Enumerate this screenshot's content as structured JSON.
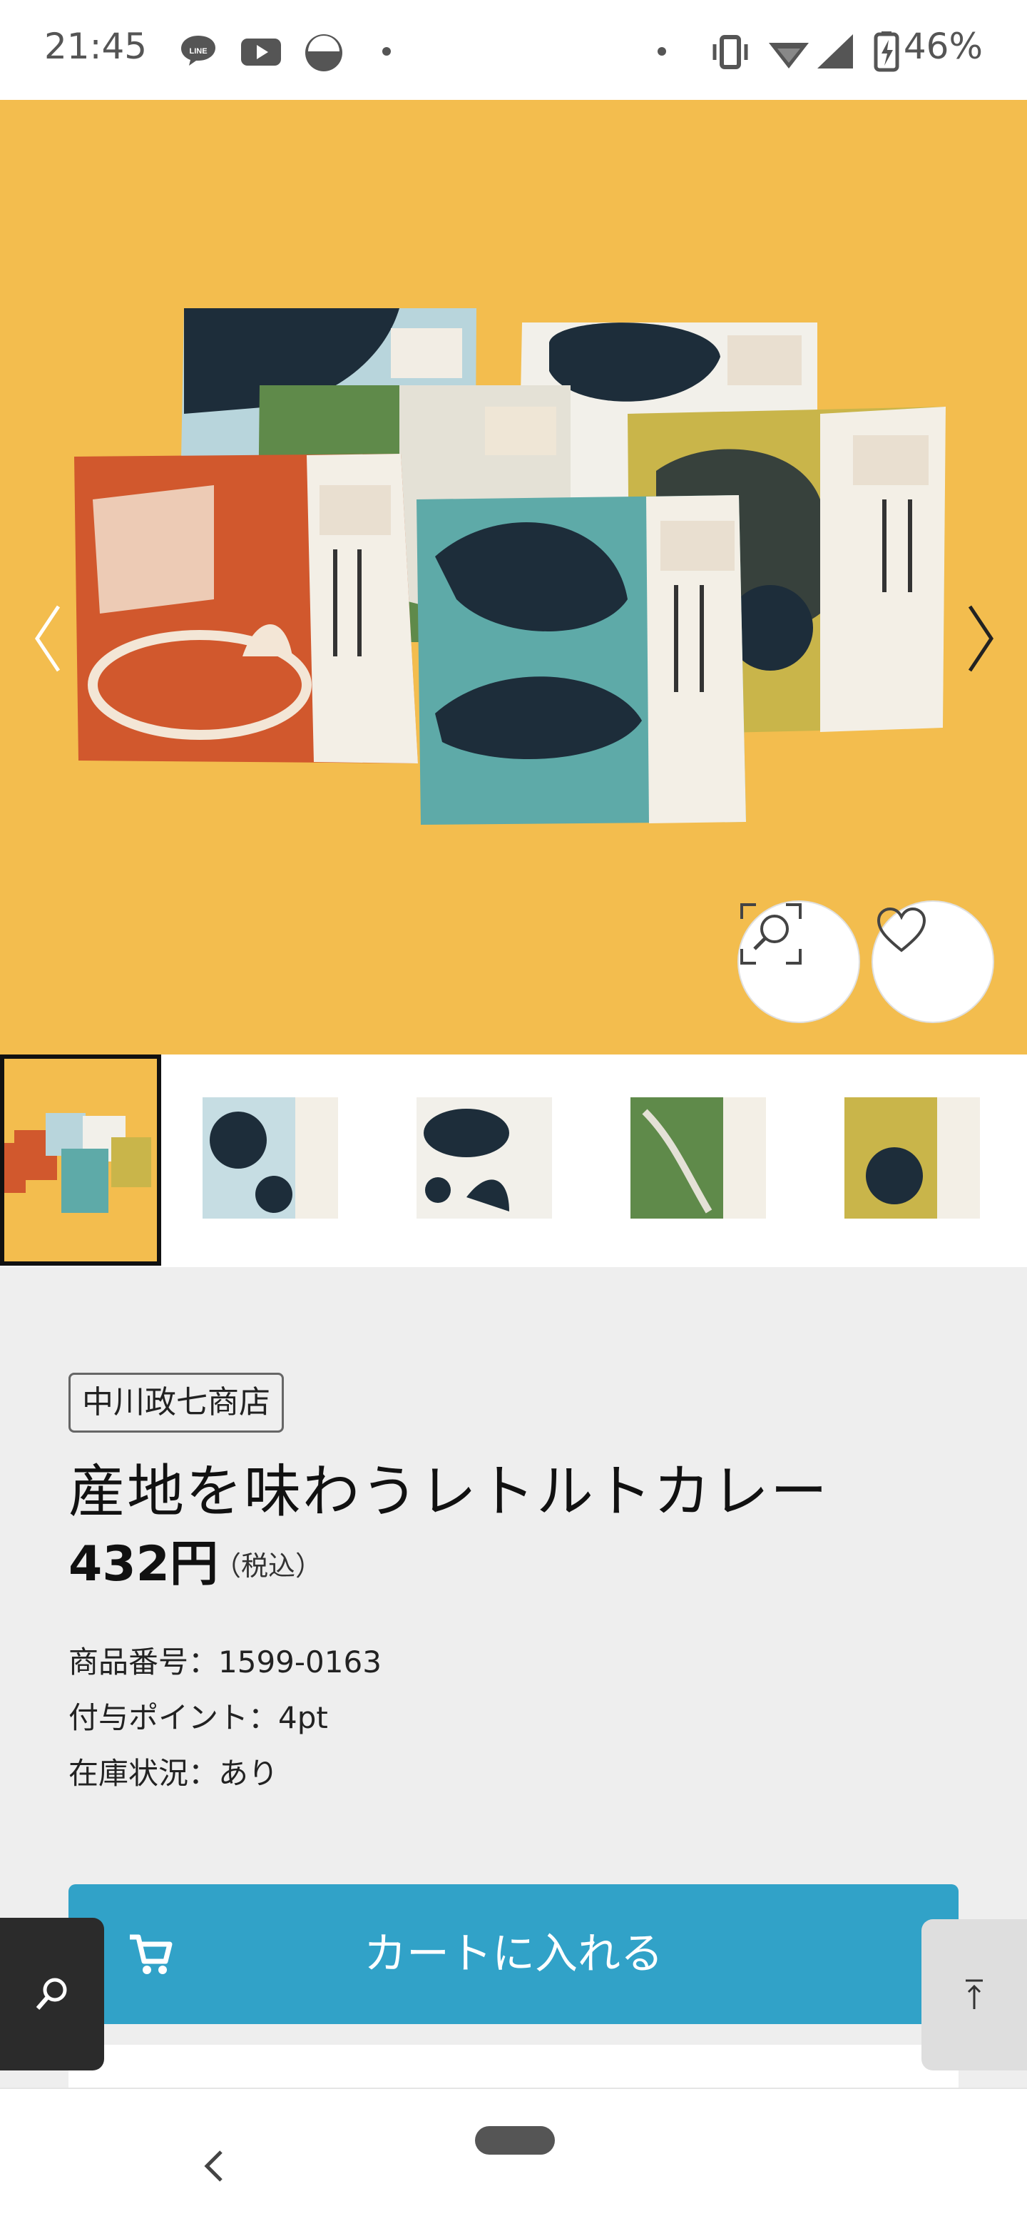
{
  "status_bar": {
    "time": "21:45",
    "battery": "46%",
    "icons": [
      "line-icon",
      "youtube-icon",
      "moon-icon",
      "dot-icon",
      "vibrate-icon",
      "wifi-icon",
      "signal-icon",
      "battery-icon"
    ]
  },
  "gallery": {
    "current_index": 0,
    "thumbnail_count": 5,
    "colors": {
      "background": "#f3bd4e",
      "orange": "#d1582d",
      "teal": "#5eaaa8",
      "green": "#5f8a4a",
      "mustard": "#c9b54a",
      "navy": "#1d2d3a"
    }
  },
  "product": {
    "brand": "中川政七商店",
    "title": "産地を味わうレトルトカレー",
    "price": "432円",
    "price_note": "（税込）",
    "meta": {
      "item_number": "商品番号：1599-0163",
      "points": "付与ポイント：4pt",
      "stock": "在庫状況：あり"
    }
  },
  "actions": {
    "cart_label": "カートに入れる",
    "accent": "#31a2c8"
  }
}
